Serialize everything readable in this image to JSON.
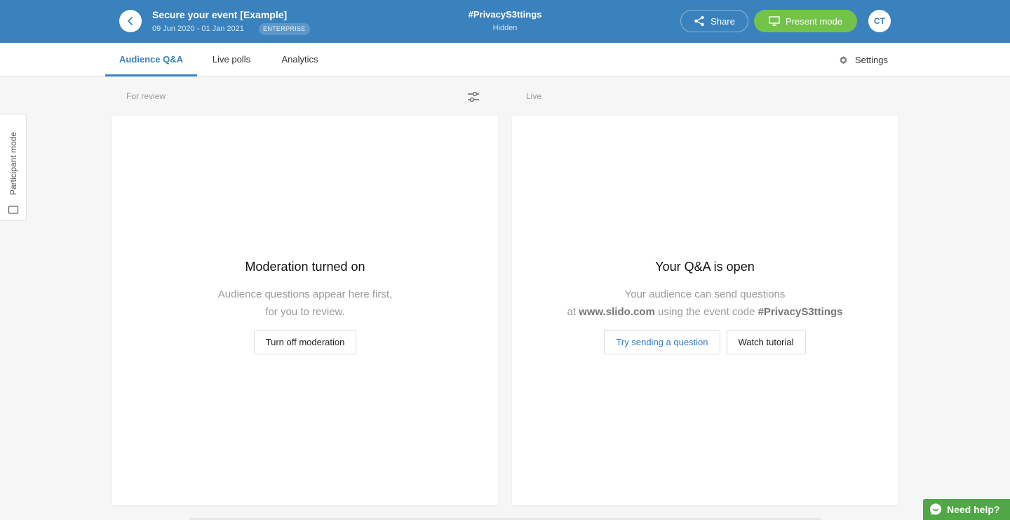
{
  "header": {
    "event_title": "Secure your event [Example]",
    "event_dates": "09 Jun 2020 - 01 Jan 2021",
    "plan_badge": "ENTERPRISE",
    "event_code": "#PrivacyS3ttings",
    "event_visibility": "Hidden",
    "share_label": "Share",
    "present_label": "Present mode",
    "avatar_initials": "CT"
  },
  "tabs": [
    {
      "label": "Audience Q&A",
      "active": true
    },
    {
      "label": "Live polls",
      "active": false
    },
    {
      "label": "Analytics",
      "active": false
    }
  ],
  "settings_label": "Settings",
  "columns": {
    "review_label": "For review",
    "live_label": "Live"
  },
  "review_card": {
    "title": "Moderation turned on",
    "text_line1": "Audience questions appear here first,",
    "text_line2": "for you to review.",
    "button_label": "Turn off moderation"
  },
  "live_card": {
    "title": "Your Q&A is open",
    "text_line1": "Your audience can send questions",
    "text_at": "at",
    "site": "www.slido.com",
    "text_middle": "using the event code",
    "code": "#PrivacyS3ttings",
    "primary_button": "Try sending a question",
    "secondary_button": "Watch tutorial"
  },
  "participant_mode_label": "Participant mode",
  "help_label": "Need help?",
  "colors": {
    "brand_blue": "#3a82bd",
    "present_green": "#73c349",
    "help_green": "#4fa845"
  },
  "icons": [
    "chevron-left-icon",
    "share-icon",
    "present-screen-icon",
    "gear-icon",
    "filter-sliders-icon",
    "device-icon",
    "chat-bubble-icon"
  ]
}
